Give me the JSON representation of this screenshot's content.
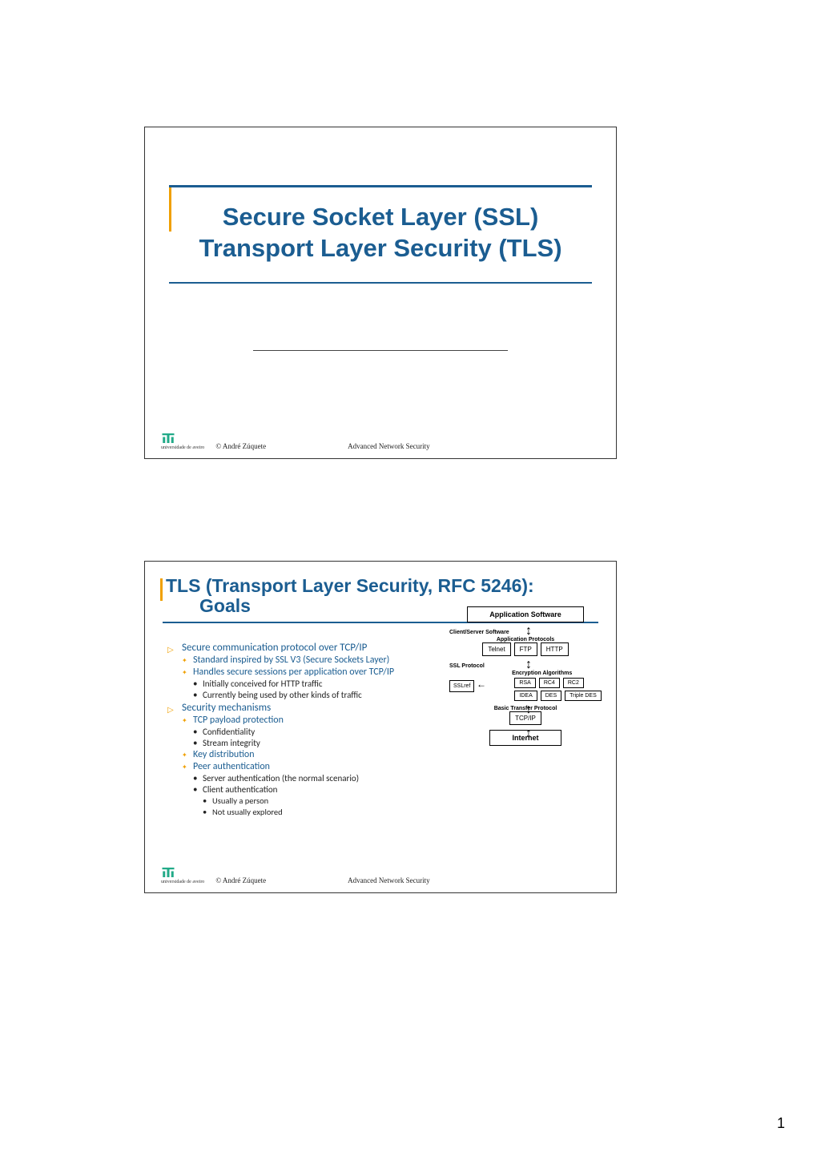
{
  "page_number": "1",
  "slide1": {
    "title_line1": "Secure Socket Layer (SSL)",
    "title_line2": "Transport Layer Security (TLS)",
    "copyright": "© André Zúquete",
    "course": "Advanced Network Security",
    "uni": "universidade de aveiro"
  },
  "slide2": {
    "title_main": "TLS (Transport Layer Security, RFC 5246):",
    "title_sub": "Goals",
    "bullets": {
      "b1": "Secure communication protocol over TCP/IP",
      "b1a": "Standard inspired by SSL V3 (Secure Sockets Layer)",
      "b1b": "Handles secure sessions per application over TCP/IP",
      "b1b1": "Initially conceived for HTTP traffic",
      "b1b2": "Currently being used by other kinds of traffic",
      "b2": "Security mechanisms",
      "b2a": "TCP payload protection",
      "b2a1": "Confidentiality",
      "b2a2": "Stream integrity",
      "b2b": "Key distribution",
      "b2c": "Peer authentication",
      "b2c1": "Server authentication (the normal scenario)",
      "b2c2": "Client authentication",
      "b2c2a": "Usually a person",
      "b2c2b": "Not usually explored"
    },
    "diagram": {
      "app_sw": "Application Software",
      "cs_sw": "Client/Server Software",
      "app_proto": "Application Protocols",
      "telnet": "Telnet",
      "ftp": "FTP",
      "http": "HTTP",
      "ssl_proto": "SSL Protocol",
      "sslref": "SSLref",
      "enc_alg": "Encryption Algorithms",
      "rsa": "RSA",
      "rc4": "RC4",
      "rc2": "RC2",
      "idea": "IDEA",
      "des": "DES",
      "tdes": "Triple DES",
      "btp": "Basic Transfer Protocol",
      "tcpip": "TCP/IP",
      "internet": "Internet"
    },
    "copyright": "© André Zúquete",
    "course": "Advanced Network Security",
    "uni": "universidade de aveiro"
  }
}
